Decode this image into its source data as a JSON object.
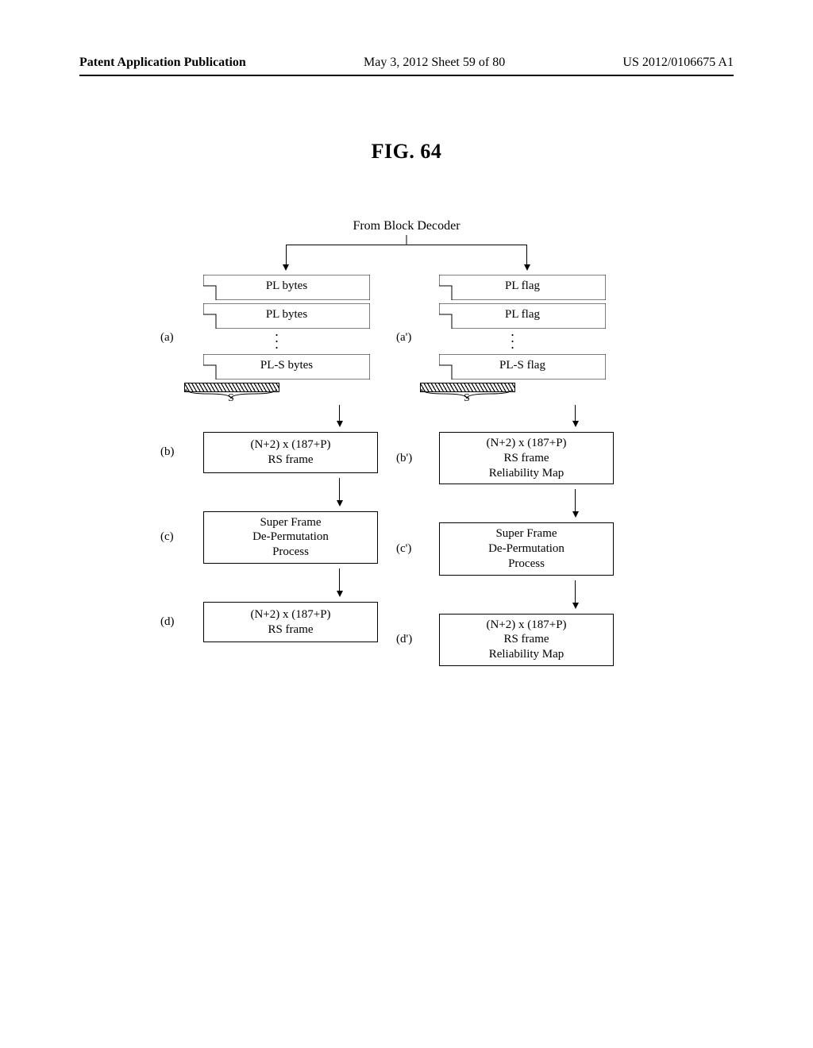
{
  "header": {
    "left": "Patent Application Publication",
    "center": "May 3, 2012  Sheet 59 of 80",
    "right": "US 2012/0106675 A1"
  },
  "figure_title": "FIG. 64",
  "top_label": "From Block Decoder",
  "left": {
    "a_label": "(a)",
    "pl1": "PL bytes",
    "pl2": "PL bytes",
    "pls": "PL-S bytes",
    "s_label": "S",
    "b_label": "(b)",
    "b_line1": "(N+2) x (187+P)",
    "b_line2": "RS frame",
    "c_label": "(c)",
    "c_line1": "Super Frame",
    "c_line2": "De-Permutation",
    "c_line3": "Process",
    "d_label": "(d)",
    "d_line1": "(N+2) x (187+P)",
    "d_line2": "RS frame"
  },
  "right": {
    "a_label": "(a')",
    "pl1": "PL flag",
    "pl2": "PL flag",
    "pls": "PL-S flag",
    "s_label": "S",
    "b_label": "(b')",
    "b_line1": "(N+2) x (187+P)",
    "b_line2": "RS frame",
    "b_line3": "Reliability Map",
    "c_label": "(c')",
    "c_line1": "Super Frame",
    "c_line2": "De-Permutation",
    "c_line3": "Process",
    "d_label": "(d')",
    "d_line1": "(N+2) x (187+P)",
    "d_line2": "RS frame",
    "d_line3": "Reliability Map"
  }
}
